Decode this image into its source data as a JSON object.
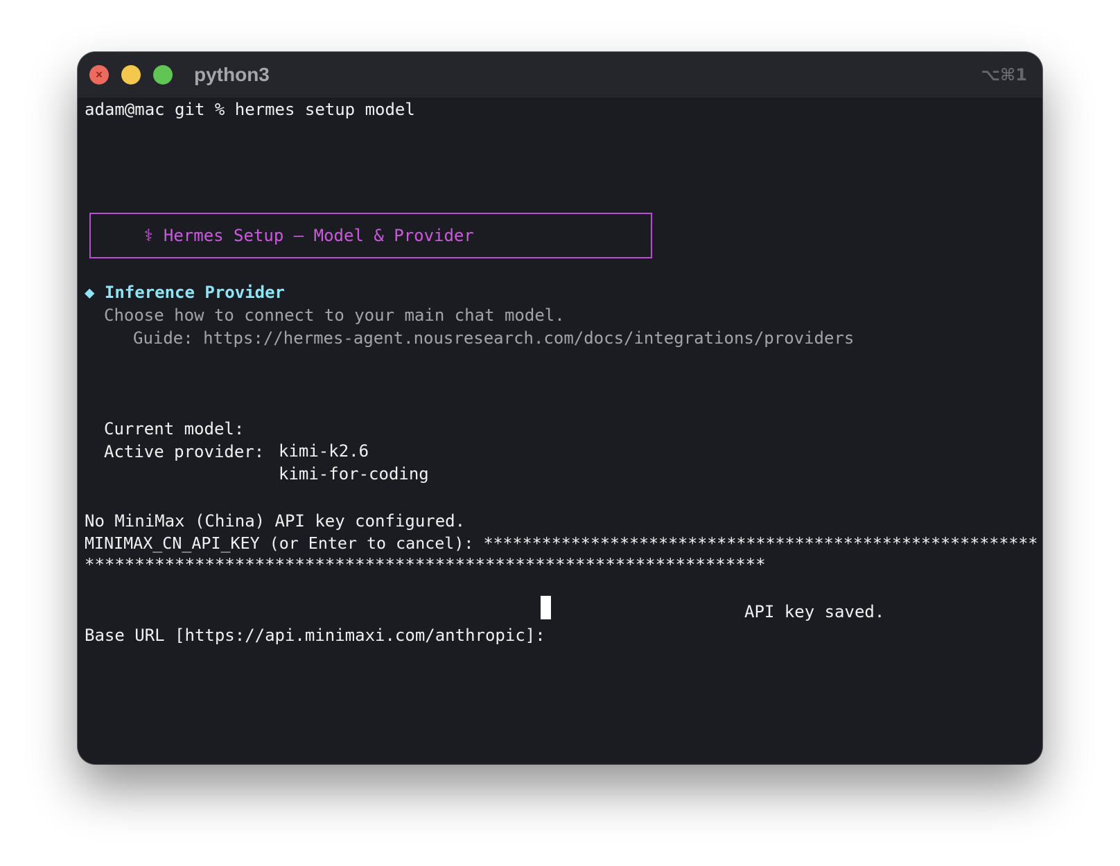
{
  "window": {
    "title": "python3",
    "shortcut": "⌥⌘1",
    "close_glyph": "×"
  },
  "terminal": {
    "prompt_line": "adam@mac git % hermes setup model",
    "banner": {
      "icon": "⚕",
      "text": "Hermes Setup — Model & Provider"
    },
    "section": {
      "bullet": "◆",
      "title": "Inference Provider",
      "description": "Choose how to connect to your main chat model.",
      "guide": "Guide: https://hermes-agent.nousresearch.com/docs/integrations/providers"
    },
    "current_model_label": "Current model:",
    "current_model_value": "kimi-k2.6",
    "active_provider_label": "Active provider:",
    "active_provider_value": "kimi-for-coding",
    "no_key_message": "No MiniMax (China) API key configured.",
    "api_key_prompt": "MINIMAX_CN_API_KEY (or Enter to cancel): *********************************************************",
    "api_key_mask_continued": "********************************************************************",
    "api_key_saved": "API key saved.",
    "base_url_prompt": "Base URL [https://api.minimaxi.com/anthropic]: "
  },
  "colors": {
    "terminal_bg": "#1b1c21",
    "titlebar_bg": "#25262b",
    "banner": "#cc59e0",
    "section_title": "#8fe5f5",
    "text": "#f1f1f1",
    "dim_text": "#a3a4a8"
  }
}
